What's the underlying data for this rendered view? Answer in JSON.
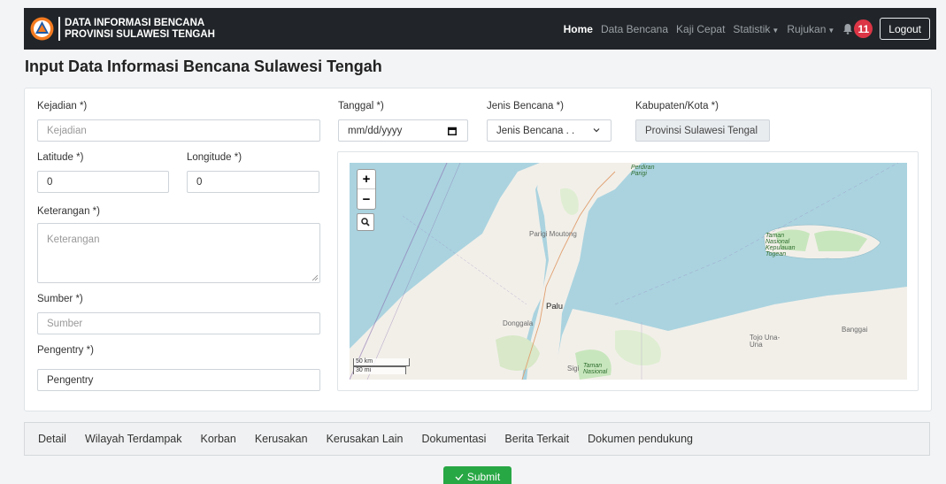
{
  "brand": {
    "line1": "DATA INFORMASI BENCANA",
    "line2": "PROVINSI SULAWESI TENGAH"
  },
  "nav": {
    "items": [
      {
        "label": "Home",
        "active": true
      },
      {
        "label": "Data Bencana"
      },
      {
        "label": "Kaji Cepat"
      },
      {
        "label": "Statistik",
        "dropdown": true
      },
      {
        "label": "Rujukan",
        "dropdown": true
      }
    ],
    "notification_count": "11",
    "logout_label": "Logout"
  },
  "page_title": "Input Data Informasi Bencana Sulawesi Tengah",
  "form": {
    "kejadian": {
      "label": "Kejadian *)",
      "placeholder": "Kejadian"
    },
    "tanggal": {
      "label": "Tanggal *)",
      "placeholder": "mm/dd/yyyy"
    },
    "jenis_bencana": {
      "label": "Jenis Bencana *)",
      "selected": "Jenis Bencana . ."
    },
    "kabupaten": {
      "label": "Kabupaten/Kota *)",
      "value": "Provinsi Sulawesi Tengal"
    },
    "latitude": {
      "label": "Latitude *)",
      "value": "0"
    },
    "longitude": {
      "label": "Longitude *)",
      "value": "0"
    },
    "keterangan": {
      "label": "Keterangan *)",
      "placeholder": "Keterangan"
    },
    "sumber": {
      "label": "Sumber *)",
      "placeholder": "Sumber"
    },
    "pengentry": {
      "label": "Pengentry *)",
      "value": "Pengentry"
    }
  },
  "map": {
    "zoom_in": "+",
    "zoom_out": "−",
    "scale_km": "50 km",
    "scale_mi": "30 mi",
    "labels": {
      "palu": "Palu",
      "parigi_moutong": "Parigi Moutong",
      "donggala": "Donggala",
      "sigi": "Sigi",
      "tojo_una_una": "Tojo Una-Una",
      "banggai": "Banggai",
      "perdiran_parigi": "Perdiran Parigi",
      "taman_nasional": "Taman Nasional",
      "taman_nasional_kepulauan": "Taman Nasional Kepulauan Togean"
    }
  },
  "tabs": [
    "Detail",
    "Wilayah Terdampak",
    "Korban",
    "Kerusakan",
    "Kerusakan Lain",
    "Dokumentasi",
    "Berita Terkait",
    "Dokumen pendukung"
  ],
  "submit_label": "Submit",
  "colors": {
    "navbar": "#212529",
    "badge": "#dc3545",
    "submit": "#28a745",
    "sea": "#aad3df",
    "land": "#f2efe9"
  }
}
